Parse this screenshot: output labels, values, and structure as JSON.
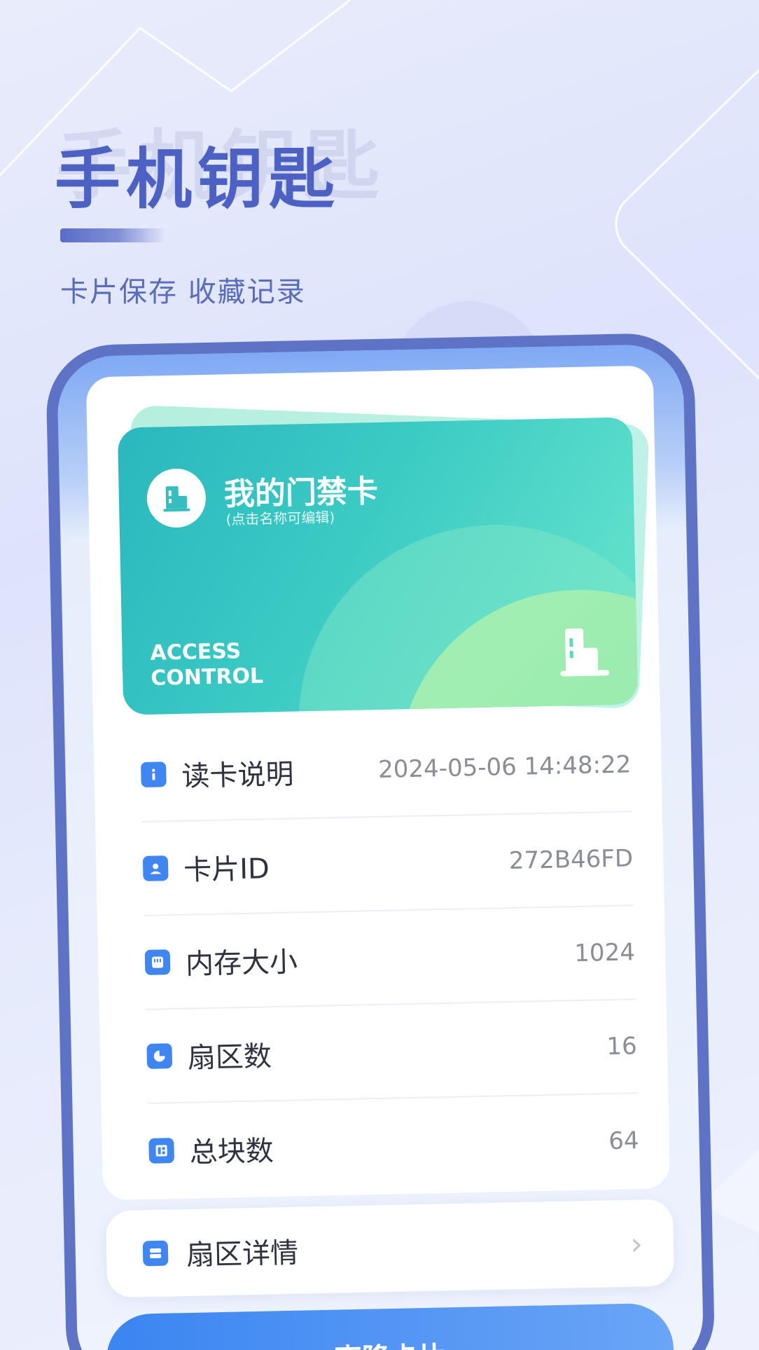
{
  "hero": {
    "title": "手机钥匙",
    "shadow_text": "手机钥匙",
    "subtitle": "卡片保存  收藏记录"
  },
  "card": {
    "name": "我的门禁卡",
    "hint": "(点击名称可编辑)",
    "type_label_line1": "ACCESS",
    "type_label_line2": "CONTROL",
    "logo_icon": "building-icon",
    "colors": {
      "start": "#2bb7be",
      "end": "#69e6cd",
      "accent": "#a6f0b4"
    }
  },
  "info": [
    {
      "icon": "info-icon",
      "label": "读卡说明",
      "value": "2024-05-06 14:48:22"
    },
    {
      "icon": "user-card-icon",
      "label": "卡片ID",
      "value": "272B46FD"
    },
    {
      "icon": "memory-icon",
      "label": "内存大小",
      "value": "1024"
    },
    {
      "icon": "pie-icon",
      "label": "扇区数",
      "value": "16"
    },
    {
      "icon": "block-icon",
      "label": "总块数",
      "value": "64"
    }
  ],
  "detail_button": {
    "label": "扇区详情",
    "icon": "list-icon",
    "chevron": "›"
  },
  "clone_button": {
    "label": "克隆卡片"
  },
  "colors": {
    "primary": "#3f86f2",
    "hero": "#4d61c4",
    "phone_frame": "#5e73c5"
  }
}
